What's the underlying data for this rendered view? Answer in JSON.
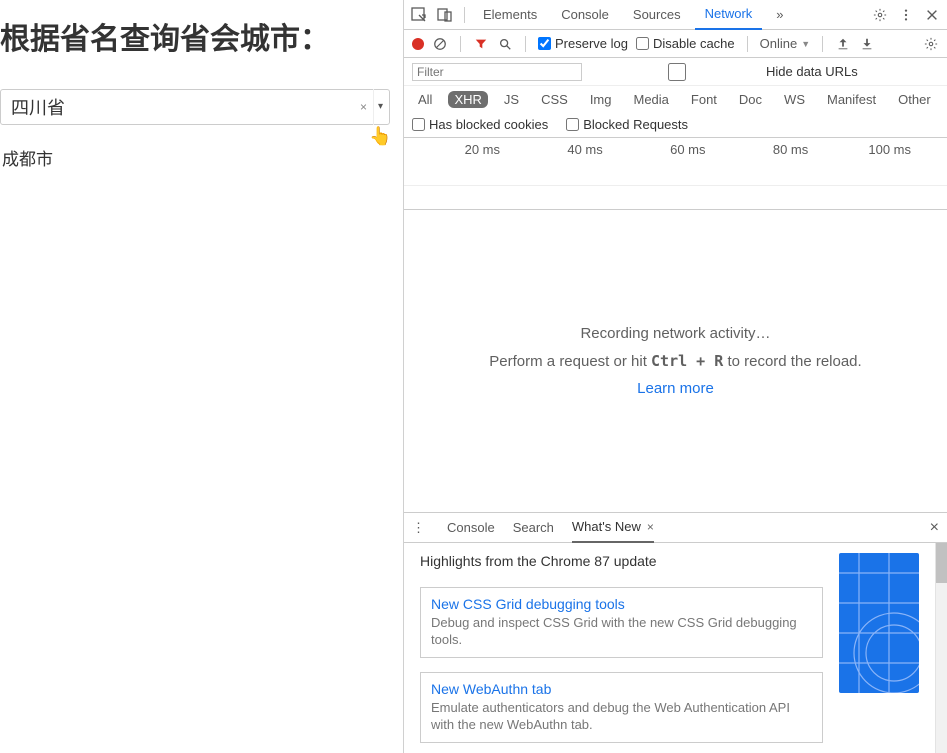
{
  "page": {
    "heading": "根据省名查询省会城市：",
    "select_value": "四川省",
    "result": "成都市"
  },
  "devtools": {
    "tabs": {
      "elements": "Elements",
      "console": "Console",
      "sources": "Sources",
      "network": "Network"
    },
    "toolbar": {
      "preserve_log": "Preserve log",
      "disable_cache": "Disable cache",
      "throttle": "Online"
    },
    "filter": {
      "placeholder": "Filter",
      "hide_data_urls": "Hide data URLs"
    },
    "types": {
      "all": "All",
      "xhr": "XHR",
      "js": "JS",
      "css": "CSS",
      "img": "Img",
      "media": "Media",
      "font": "Font",
      "doc": "Doc",
      "ws": "WS",
      "manifest": "Manifest",
      "other": "Other"
    },
    "blockbar": {
      "blocked_cookies": "Has blocked cookies",
      "blocked_requests": "Blocked Requests"
    },
    "timeline": {
      "t1": "20 ms",
      "t2": "40 ms",
      "t3": "60 ms",
      "t4": "80 ms",
      "t5": "100 ms"
    },
    "empty": {
      "line1": "Recording network activity…",
      "hint_pre": "Perform a request or hit ",
      "hint_key": "Ctrl + R",
      "hint_post": " to record the reload.",
      "learn": "Learn more"
    },
    "drawer": {
      "tabs": {
        "console": "Console",
        "search": "Search",
        "whatsnew": "What's New"
      },
      "highlights_title": "Highlights from the Chrome 87 update",
      "cards": {
        "grid_t": "New CSS Grid debugging tools",
        "grid_d": "Debug and inspect CSS Grid with the new CSS Grid debugging tools.",
        "webauthn_t": "New WebAuthn tab",
        "webauthn_d": "Emulate authenticators and debug the Web Authentication API with the new WebAuthn tab."
      }
    }
  }
}
